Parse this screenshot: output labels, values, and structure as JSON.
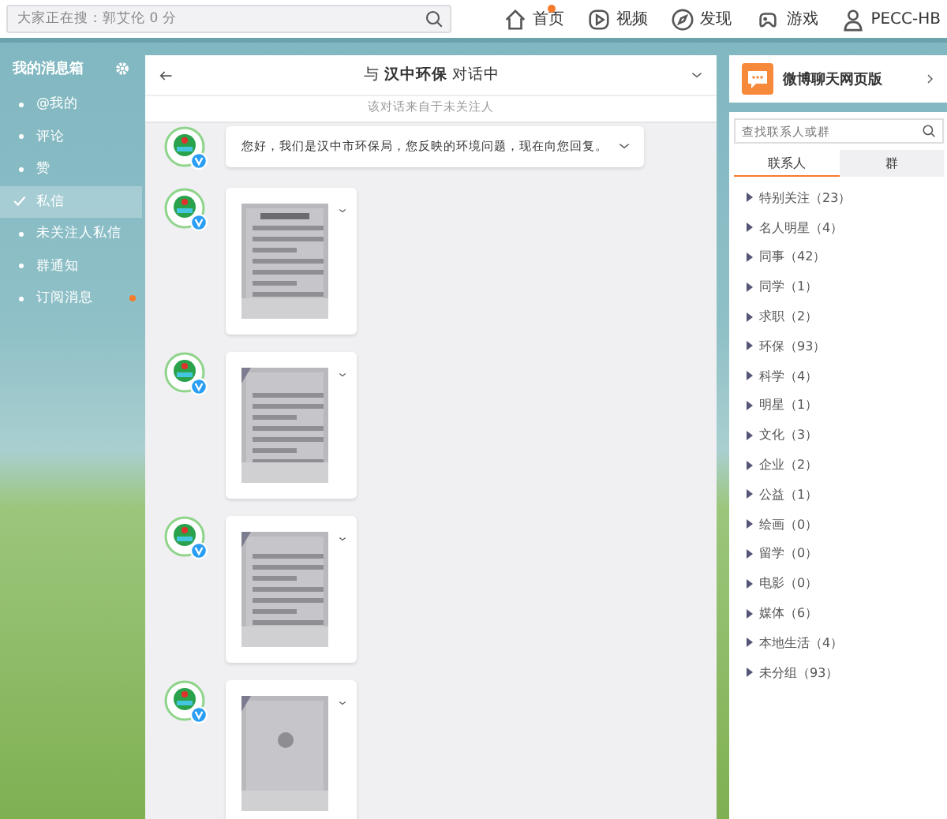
{
  "top_bar": {
    "search": {
      "placeholder": "大家正在搜：郭艾伦 0 分"
    },
    "nav": [
      {
        "kind": "home",
        "label": "首页",
        "notification": true
      },
      {
        "kind": "video",
        "label": "视频",
        "notification": false
      },
      {
        "kind": "discover",
        "label": "发现",
        "notification": false
      },
      {
        "kind": "game",
        "label": "游戏",
        "notification": false
      },
      {
        "kind": "user",
        "label": "PECC-HB",
        "notification": false
      }
    ]
  },
  "sidebar": {
    "title": "我的消息箱",
    "items": [
      {
        "label": "@我的",
        "selected": false,
        "unread": false
      },
      {
        "label": "评论",
        "selected": false,
        "unread": false
      },
      {
        "label": "赞",
        "selected": false,
        "unread": false
      },
      {
        "label": "私信",
        "selected": true,
        "unread": false
      },
      {
        "label": "未关注人私信",
        "selected": false,
        "unread": false
      },
      {
        "label": "群通知",
        "selected": false,
        "unread": false
      },
      {
        "label": "订阅消息",
        "selected": false,
        "unread": true
      }
    ]
  },
  "chat": {
    "title": "与 **汉中环保** 对话中",
    "subtitle": "该对话来自于未关注人",
    "messages": [
      {
        "kind": "text",
        "text": "您好，我们是汉中市环保局，您反映的环境问题，现在向您回复。"
      },
      {
        "kind": "picture"
      },
      {
        "kind": "picture"
      },
      {
        "kind": "picture"
      },
      {
        "kind": "picture"
      }
    ]
  },
  "contacts": {
    "title": "微博聊天网页版",
    "search": {
      "placeholder": "查找联系人或群"
    },
    "tabs": [
      {
        "label": "联系人",
        "selected": true
      },
      {
        "label": "群",
        "selected": false
      }
    ],
    "groups": [
      {
        "label": "特别关注（23）"
      },
      {
        "label": "名人明星（4）"
      },
      {
        "label": "同事（42）"
      },
      {
        "label": "同学（1）"
      },
      {
        "label": "求职（2）"
      },
      {
        "label": "环保（93）"
      },
      {
        "label": "科学（4）"
      },
      {
        "label": "明星（1）"
      },
      {
        "label": "文化（3）"
      },
      {
        "label": "企业（2）"
      },
      {
        "label": "公益（1）"
      },
      {
        "label": "绘画（0）"
      },
      {
        "label": "留学（0）"
      },
      {
        "label": "电影（0）"
      },
      {
        "label": "媒体（6）"
      },
      {
        "label": "本地生活（4）"
      },
      {
        "label": "未分组（93）"
      }
    ]
  }
}
